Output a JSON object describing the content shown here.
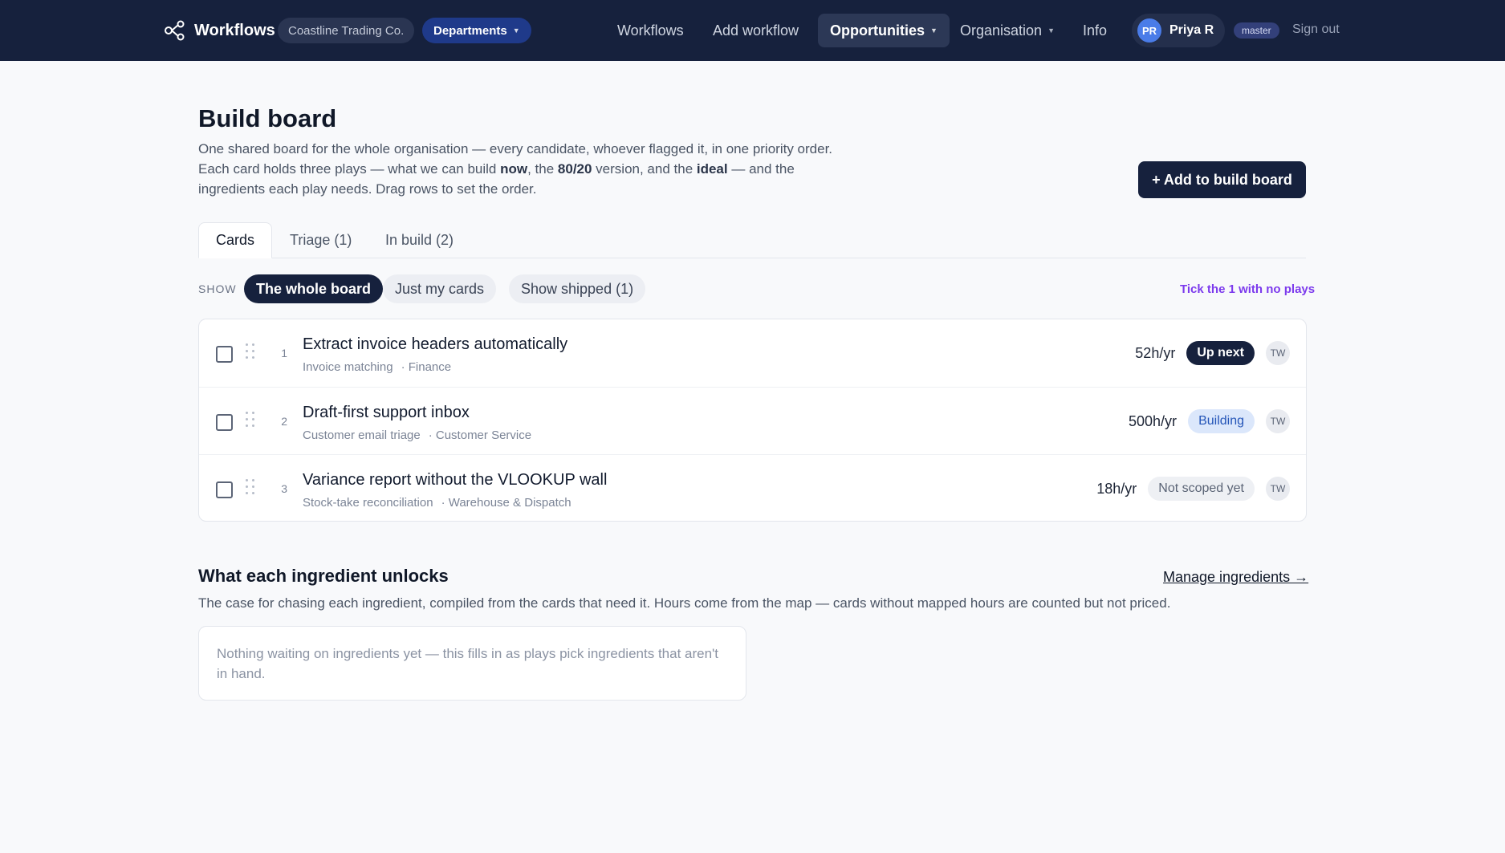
{
  "header": {
    "brand": "Workflows",
    "org": "Coastline Trading Co.",
    "departments": "Departments",
    "nav": [
      {
        "label": "Workflows"
      },
      {
        "label": "Add workflow"
      },
      {
        "label": "Opportunities"
      },
      {
        "label": "Organisation"
      },
      {
        "label": "Info"
      }
    ],
    "user": {
      "initials": "PR",
      "name": "Priya R"
    },
    "branch": "master",
    "sign_out": "Sign out"
  },
  "page": {
    "title": "Build board",
    "description": {
      "line1": "One shared board for the whole organisation — every candidate, whoever flagged it, in one priority order.",
      "line2_a": "Each card holds three plays — what we can build ",
      "line2_b": "now",
      "line2_c": ", the ",
      "line2_d": "80/20",
      "line2_e": " version, and the ",
      "line2_f": "ideal",
      "line2_g": " — and the",
      "line3": "ingredients each play needs. Drag rows to set the order."
    },
    "add_button": "+ Add to build board"
  },
  "tabs": [
    {
      "label": "Cards"
    },
    {
      "label": "Triage (1)"
    },
    {
      "label": "In build (2)"
    }
  ],
  "filters": {
    "show_label": "SHOW",
    "chips": [
      {
        "label": "The whole board"
      },
      {
        "label": "Just my cards"
      },
      {
        "label": "Show shipped (1)"
      }
    ],
    "tick_link": "Tick the 1 with no plays"
  },
  "cards": [
    {
      "num": "1",
      "title": "Extract invoice headers automatically",
      "workflow": "Invoice matching",
      "dept": "· Finance",
      "hours": "52h/yr",
      "status": "Up next",
      "owner": "TW"
    },
    {
      "num": "2",
      "title": "Draft-first support inbox",
      "workflow": "Customer email triage",
      "dept": "· Customer Service",
      "hours": "500h/yr",
      "status": "Building",
      "owner": "TW"
    },
    {
      "num": "3",
      "title": "Variance report without the VLOOKUP wall",
      "workflow": "Stock-take reconciliation",
      "dept": "· Warehouse & Dispatch",
      "hours": "18h/yr",
      "status": "Not scoped yet",
      "owner": "TW"
    }
  ],
  "ingredients": {
    "title": "What each ingredient unlocks",
    "manage_link": "Manage ingredients →",
    "description": "The case for chasing each ingredient, compiled from the cards that need it. Hours come from the map — cards without mapped hours are counted but not priced.",
    "empty": "Nothing waiting on ingredients yet — this fills in as plays pick ingredients that aren't in hand."
  },
  "colors": {
    "navbar": "#16213d",
    "accent_link": "#7c3aed",
    "building_badge": "#dbe7fb"
  }
}
